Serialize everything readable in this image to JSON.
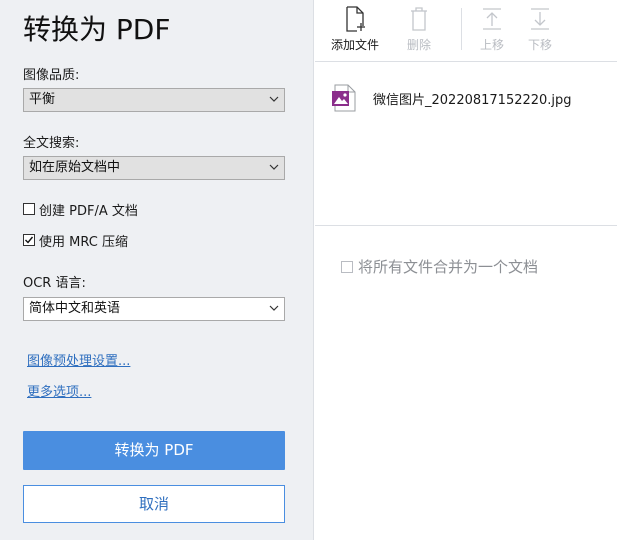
{
  "title": "转换为 PDF",
  "image_quality": {
    "label": "图像品质:",
    "value": "平衡"
  },
  "fulltext_search": {
    "label": "全文搜索:",
    "value": "如在原始文档中"
  },
  "create_pdfa": {
    "label": "创建 PDF/A 文档",
    "checked": false
  },
  "use_mrc": {
    "label": "使用 MRC 压缩",
    "checked": true
  },
  "ocr_language": {
    "label": "OCR 语言:",
    "value": "简体中文和英语"
  },
  "links": {
    "preprocess": "图像预处理设置...",
    "more_options": "更多选项..."
  },
  "buttons": {
    "convert": "转换为 PDF",
    "cancel": "取消"
  },
  "toolbar": {
    "add": {
      "label": "添加文件",
      "icon": "add-file-icon",
      "enabled": true
    },
    "delete": {
      "label": "删除",
      "icon": "trash-icon",
      "enabled": false
    },
    "up": {
      "label": "上移",
      "icon": "move-up-icon",
      "enabled": false
    },
    "down": {
      "label": "下移",
      "icon": "move-down-icon",
      "enabled": false
    }
  },
  "files": [
    {
      "name": "微信图片_20220817152220.jpg",
      "icon": "image-file-icon"
    }
  ],
  "merge_option": {
    "label": "将所有文件合并为一个文档",
    "checked": false,
    "enabled": false
  },
  "colors": {
    "accent": "#4a8ee0",
    "link": "#2f6fbf",
    "panel_bg": "#eef0f3",
    "file_icon": "#8b2e8b"
  }
}
